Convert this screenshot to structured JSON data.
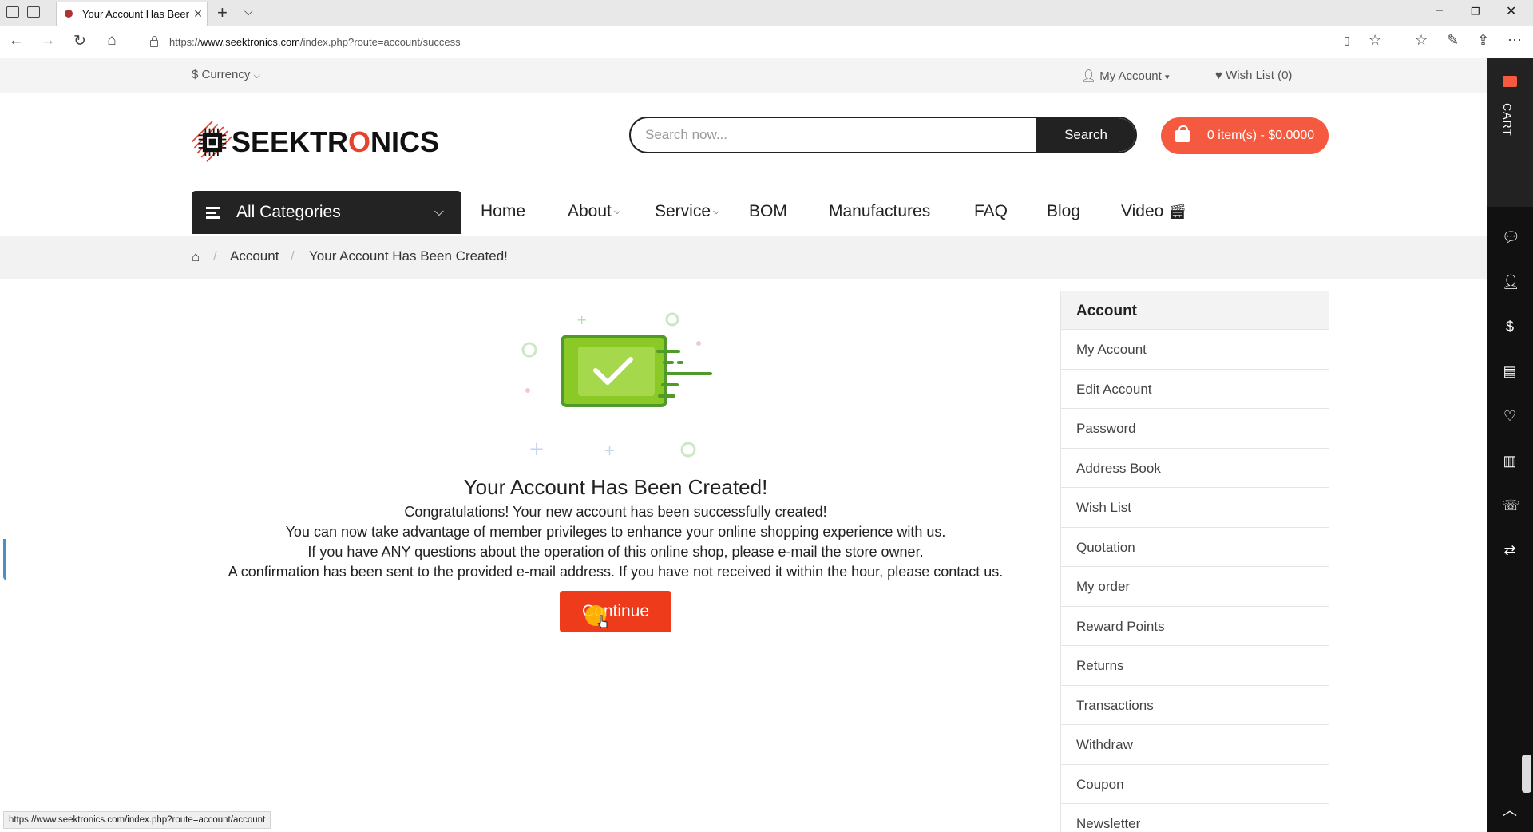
{
  "browser": {
    "tab_title": "Your Account Has Been",
    "url_prefix": "https://",
    "url_host": "www.seektronics.com",
    "url_path": "/index.php?route=account/success",
    "status_url": "https://www.seektronics.com/index.php?route=account/account"
  },
  "topbar": {
    "currency": "$ Currency",
    "my_account": "My Account",
    "wish_list": "Wish List (0)"
  },
  "header": {
    "logo_text_pre": "SEEKTR",
    "logo_text_o": "O",
    "logo_text_post": "NICS",
    "search_placeholder": "Search now...",
    "search_button": "Search",
    "cart_summary": "0 item(s) - $0.0000"
  },
  "nav": {
    "categories_label": "All Categories",
    "items": [
      "Home",
      "About",
      "Service",
      "BOM",
      "Manufactures",
      "FAQ",
      "Blog",
      "Video"
    ]
  },
  "breadcrumb": {
    "account": "Account",
    "current": "Your Account Has Been Created!"
  },
  "success": {
    "title": "Your Account Has Been Created!",
    "lines": [
      "Congratulations! Your new account has been successfully created!",
      "You can now take advantage of member privileges to enhance your online shopping experience with us.",
      "If you have ANY questions about the operation of this online shop, please e-mail the store owner.",
      "A confirmation has been sent to the provided e-mail address. If you have not received it within the hour, please contact us."
    ],
    "continue_button": "Continue"
  },
  "account_sidebar": {
    "heading": "Account",
    "items": [
      "My Account",
      "Edit Account",
      "Password",
      "Address Book",
      "Wish List",
      "Quotation",
      "My order",
      "Reward Points",
      "Returns",
      "Transactions",
      "Withdraw",
      "Coupon",
      "Newsletter"
    ]
  },
  "dock": {
    "cart_label": "CART"
  },
  "colors": {
    "accent": "#f55a40",
    "button_red": "#ee3b1c",
    "dark": "#232323",
    "illustration_green": "#7ac943"
  }
}
